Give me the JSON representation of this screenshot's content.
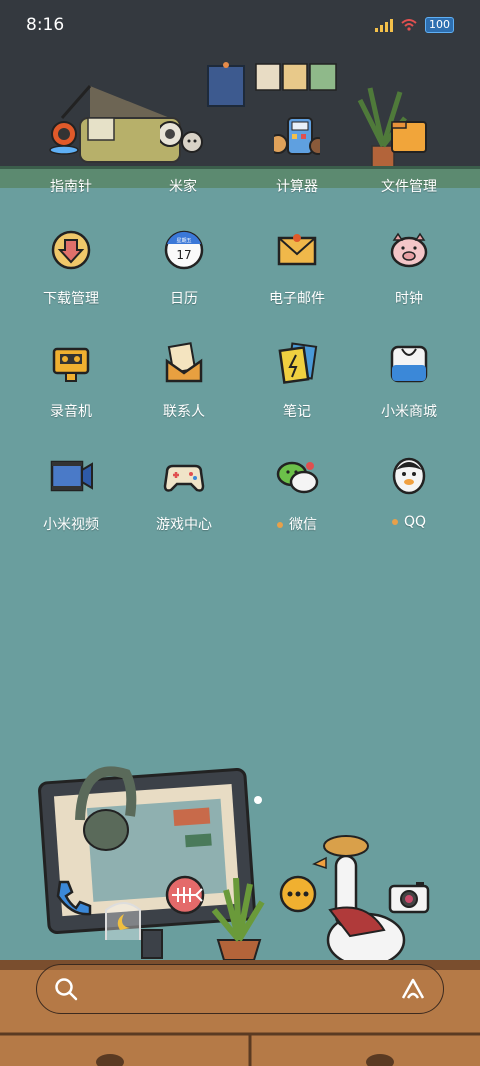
{
  "status": {
    "time": "8:16",
    "battery": "100"
  },
  "dock_row": [
    {
      "label": "指南针",
      "icon": "compass-lamp-icon"
    },
    {
      "label": "米家",
      "icon": "mijia-icon"
    },
    {
      "label": "计算器",
      "icon": "calculator-icon"
    },
    {
      "label": "文件管理",
      "icon": "folder-icon"
    }
  ],
  "apps": [
    {
      "label": "下载管理",
      "icon": "download-icon"
    },
    {
      "label": "日历",
      "icon": "calendar-icon",
      "calendar_day": "17",
      "calendar_weekday": "星期五"
    },
    {
      "label": "电子邮件",
      "icon": "mail-icon"
    },
    {
      "label": "时钟",
      "icon": "pig-clock-icon"
    },
    {
      "label": "录音机",
      "icon": "recorder-icon"
    },
    {
      "label": "联系人",
      "icon": "contacts-icon"
    },
    {
      "label": "笔记",
      "icon": "notes-icon"
    },
    {
      "label": "小米商城",
      "icon": "shop-icon"
    },
    {
      "label": "小米视频",
      "icon": "video-icon"
    },
    {
      "label": "游戏中心",
      "icon": "gamepad-icon"
    },
    {
      "label": "微信",
      "icon": "wechat-icon",
      "new_dot": true
    },
    {
      "label": "QQ",
      "icon": "qq-icon",
      "new_dot": true
    }
  ],
  "bottom_icons": [
    "phone-icon",
    "fish-bone-icon",
    "message-icon",
    "camera-icon"
  ],
  "search": {
    "icon": "search-icon",
    "assistant_icon": "assistant-icon"
  },
  "colors": {
    "wall": "#34393f",
    "background": "#6a9e9e",
    "desk": "#b57a47",
    "accent_dot": "#e8a04a"
  }
}
